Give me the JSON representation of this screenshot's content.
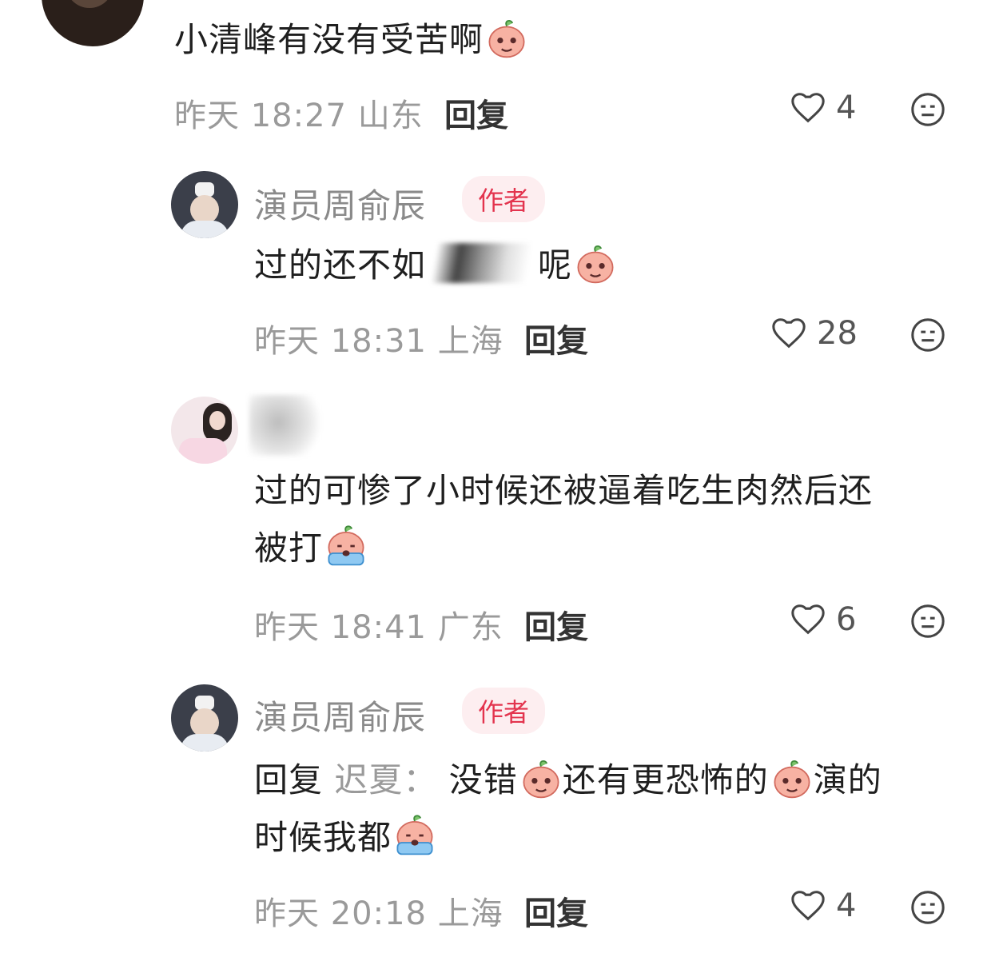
{
  "comments": [
    {
      "text": "小清峰有没有受苦啊",
      "time": "昨天 18:27",
      "location": "山东",
      "reply_label": "回复",
      "likes": "4"
    },
    {
      "author": "演员周俞辰",
      "badge": "作者",
      "text_start": "过的还不如",
      "text_end": "呢",
      "time": "昨天 18:31",
      "location": "上海",
      "reply_label": "回复",
      "likes": "28"
    },
    {
      "text_line1": "过的可惨了小时候还被逼着吃生肉然后还",
      "text_line2": "被打",
      "time": "昨天 18:41",
      "location": "广东",
      "reply_label": "回复",
      "likes": "6"
    },
    {
      "author": "演员周俞辰",
      "badge": "作者",
      "reply_prefix": "回复",
      "reply_to": "迟夏：",
      "text_a": "没错",
      "text_b": "还有更恐怖的",
      "text_c": "演的",
      "text_line2": "时候我都",
      "time": "昨天 20:18",
      "location": "上海",
      "reply_label": "回复",
      "likes": "4"
    }
  ],
  "colors": {
    "badge_text": "#e3344e",
    "badge_bg": "#fdeef0",
    "meta": "#9a9a9a"
  },
  "icons": [
    "heart-outline-icon",
    "meh-face-icon",
    "peach-emoji-icon"
  ]
}
